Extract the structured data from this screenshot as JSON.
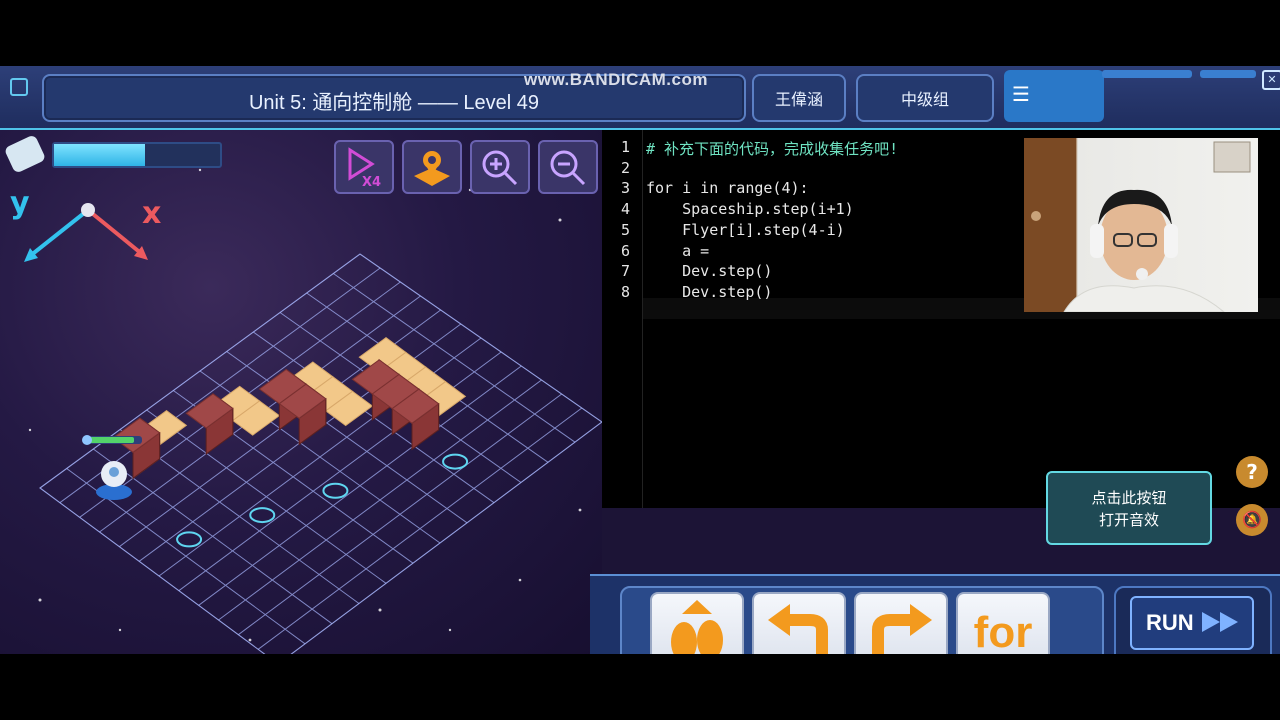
{
  "header": {
    "title": "Unit 5: 通向控制舱 —— Level 49",
    "watermark": "www.BANDICAM.com",
    "student_name": "王偉涵",
    "group": "中级组"
  },
  "game": {
    "energy_level": 0.55,
    "axis_y_label": "y",
    "axis_x_label": "x",
    "tools": [
      "speed-x4-icon",
      "map-icon",
      "zoom-in-icon",
      "zoom-out-icon"
    ],
    "speed_label": "X4"
  },
  "editor": {
    "lines": [
      {
        "num": "1",
        "text": "# 补充下面的代码，完成收集任务吧!"
      },
      {
        "num": "2",
        "text": ""
      },
      {
        "num": "3",
        "text": "for i in range(4):"
      },
      {
        "num": "4",
        "text": "    Spaceship.step(i+1)"
      },
      {
        "num": "5",
        "text": "    Flyer[i].step(4-i)"
      },
      {
        "num": "6",
        "text": "    a ="
      },
      {
        "num": "7",
        "text": "    Dev.step()"
      },
      {
        "num": "8",
        "text": "    Dev.step()"
      }
    ]
  },
  "sound_notice": {
    "line1": "点击此按钮",
    "line2": "打开音效"
  },
  "help_symbol": "?",
  "blocks": [
    {
      "label": "step",
      "icon": "step-arrow-icon"
    },
    {
      "label": "turnLeft",
      "icon": "turn-left-arrow-icon"
    },
    {
      "label": "turnRight",
      "icon": "turn-right-arrow-icon"
    },
    {
      "label": "for",
      "icon": "for-loop-icon"
    }
  ],
  "for_icon_text": "for",
  "run": {
    "label": "RUN"
  },
  "colors": {
    "accent": "#4fc3e8",
    "axis_y": "#33c2ee",
    "axis_x": "#ec5a5f",
    "block_orange": "#f39a1e"
  }
}
